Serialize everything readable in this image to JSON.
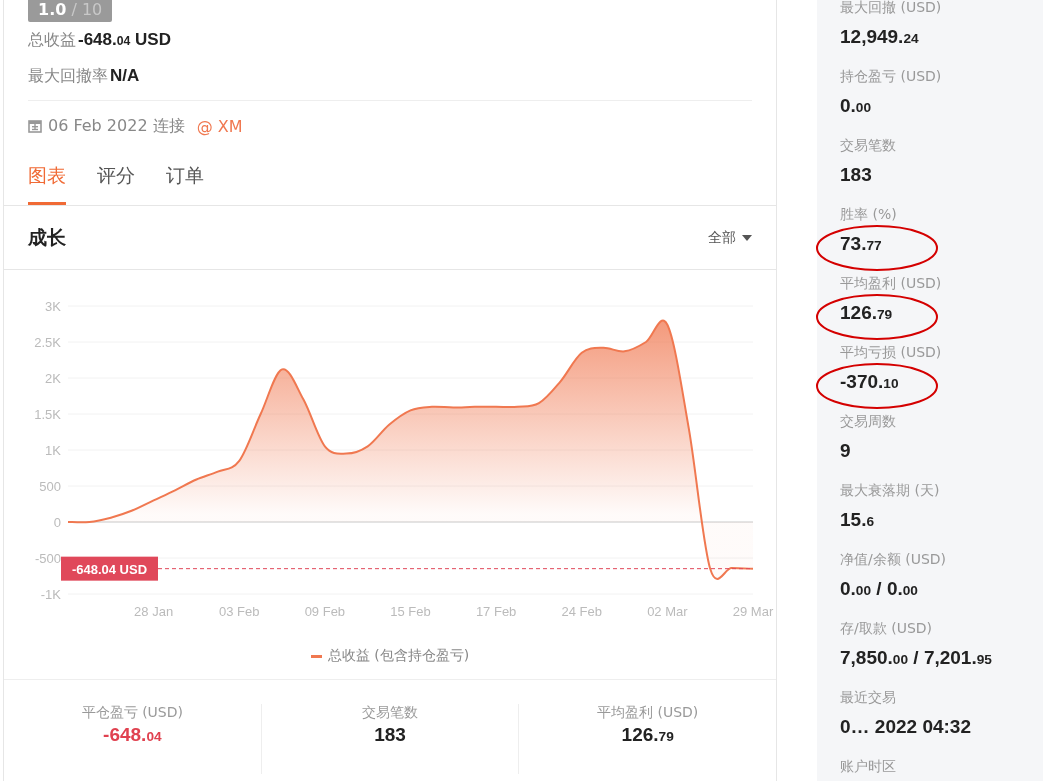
{
  "rating": {
    "score": "1.0",
    "scale": "/ 10"
  },
  "summary": [
    {
      "label": "总收益",
      "value": "-648.04 USD"
    },
    {
      "label": "最大回撤率",
      "value": "N/A"
    }
  ],
  "connection": {
    "date": "06 Feb 2022 连接",
    "broker": "@ XM"
  },
  "tabs": [
    {
      "label": "图表",
      "selected": true
    },
    {
      "label": "评分",
      "selected": false
    },
    {
      "label": "订单",
      "selected": false
    }
  ],
  "growth": {
    "title": "成长",
    "filter": "全部",
    "chart_data": {
      "type": "area",
      "categories": [
        null,
        null,
        null,
        null,
        "28 Jan",
        null,
        null,
        null,
        "03 Feb",
        null,
        null,
        null,
        "09 Feb",
        null,
        null,
        null,
        "15 Feb",
        null,
        null,
        null,
        "17 Feb",
        null,
        null,
        null,
        "24 Feb",
        null,
        null,
        null,
        "02 Mar",
        null,
        null,
        null,
        "29 Mar"
      ],
      "series": [
        {
          "name": "总收益 (包含持仓盈亏)",
          "color": "#f07850",
          "values": [
            0,
            0,
            60,
            160,
            300,
            440,
            590,
            700,
            850,
            1500,
            2120,
            1700,
            1050,
            950,
            1050,
            1350,
            1550,
            1600,
            1590,
            1600,
            1600,
            1600,
            1650,
            1950,
            2350,
            2420,
            2370,
            2500,
            2740,
            1300,
            -650,
            -640,
            -650
          ]
        }
      ],
      "ylim": [
        -1000,
        3000
      ],
      "yticks": [
        {
          "value": 3000,
          "label": "3K"
        },
        {
          "value": 2500,
          "label": "2.5K"
        },
        {
          "value": 2000,
          "label": "2K"
        },
        {
          "value": 1500,
          "label": "1.5K"
        },
        {
          "value": 1000,
          "label": "1K"
        },
        {
          "value": 500,
          "label": "500"
        },
        {
          "value": 0,
          "label": "0"
        },
        {
          "value": -500,
          "label": "-500"
        },
        {
          "value": -1000,
          "label": "-1K"
        }
      ],
      "grid": true,
      "ref_lines": [
        {
          "axis": "y",
          "value": -648.04,
          "color": "#e0485a"
        }
      ],
      "annotations": [
        "-648.04 USD"
      ]
    }
  },
  "bottom_stats": [
    {
      "label": "平仓盈亏 (USD)",
      "value": "-648.04",
      "color": "#e0414f"
    },
    {
      "label": "交易笔数",
      "value": "183",
      "color": "#222222"
    },
    {
      "label": "平均盈利 (USD)",
      "value": "126.79",
      "color": "#222222"
    }
  ],
  "stats": [
    {
      "label": "最大回撤 (USD)",
      "value": "12,949.24",
      "highlighted": false
    },
    {
      "label": "持仓盈亏 (USD)",
      "value": "0.00",
      "highlighted": false
    },
    {
      "label": "交易笔数",
      "value": "183",
      "highlighted": false
    },
    {
      "label": "胜率 (%)",
      "value": "73.77",
      "highlighted": true
    },
    {
      "label": "平均盈利 (USD)",
      "value": "126.79",
      "highlighted": true
    },
    {
      "label": "平均亏损 (USD)",
      "value": "-370.10",
      "highlighted": true
    },
    {
      "label": "交易周数",
      "value": "9",
      "highlighted": false
    },
    {
      "label": "最大衰落期 (天)",
      "value": "15.6",
      "highlighted": false
    },
    {
      "label": "净值/余额 (USD)",
      "value": "0.00 / 0.00",
      "highlighted": false
    },
    {
      "label": "存/取款 (USD)",
      "value": "7,850.00 / 7,201.95",
      "highlighted": false
    },
    {
      "label": "最近交易",
      "value": "0… 2022 04:32",
      "highlighted": false
    },
    {
      "label": "账户时区",
      "highlighted": false
    }
  ]
}
